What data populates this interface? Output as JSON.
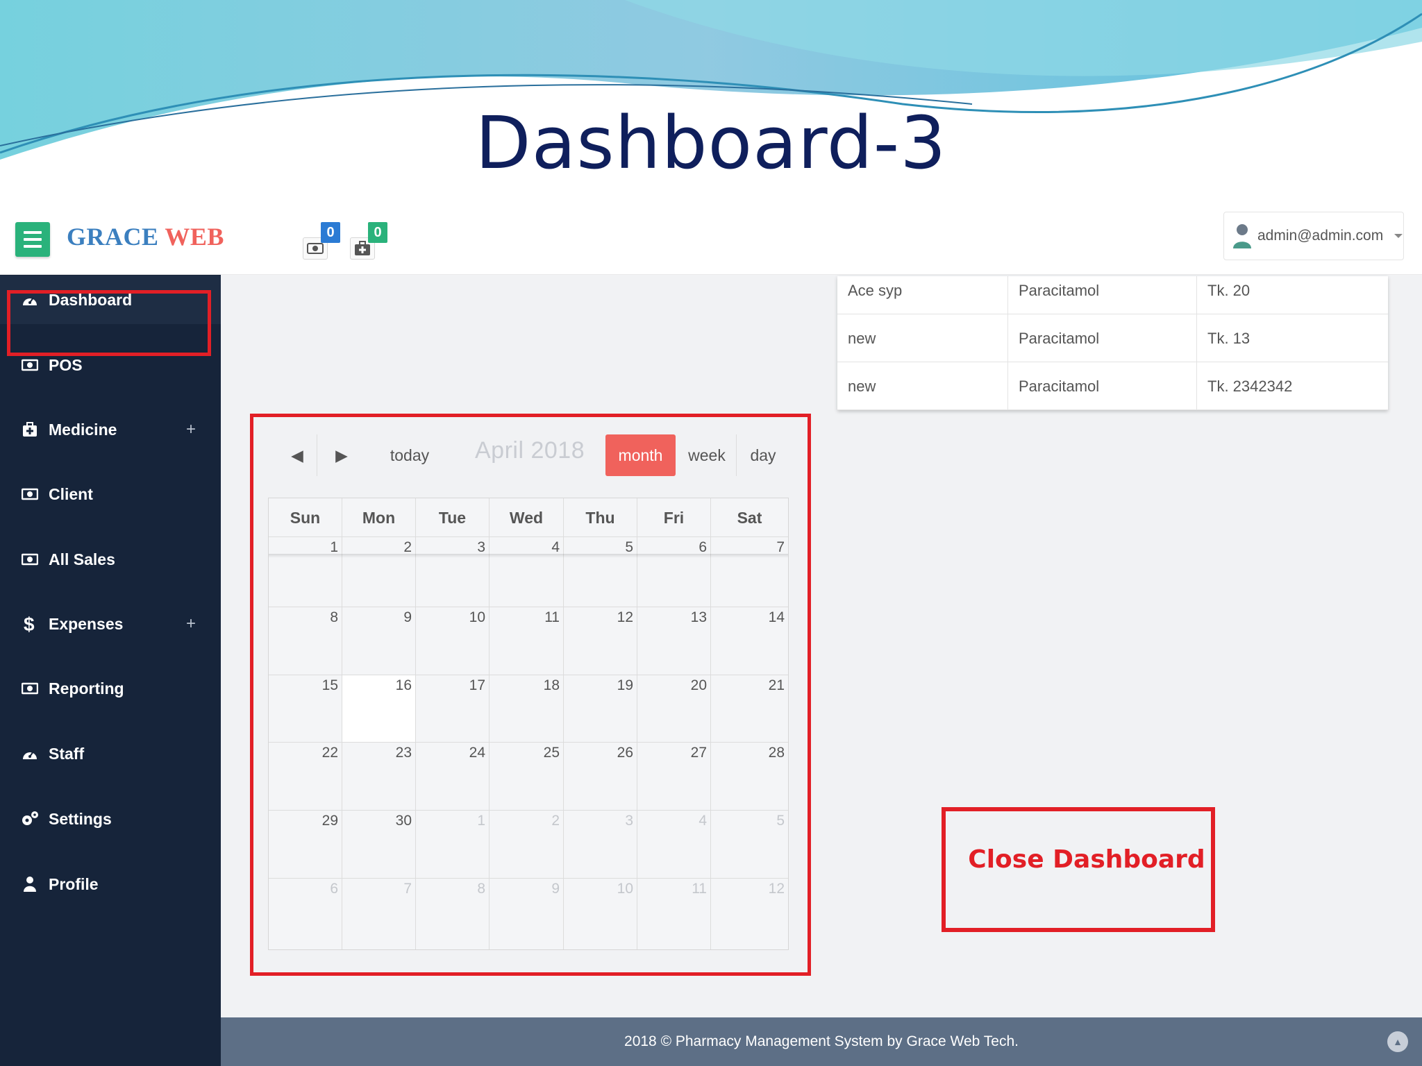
{
  "slide": {
    "title": "Dashboard-3"
  },
  "header": {
    "brand_part1": "GRACE",
    "brand_part2": "WEB",
    "sales_badge": "0",
    "medicine_badge": "0",
    "user": "admin@admin.com"
  },
  "sidebar": {
    "items": [
      {
        "label": "Dashboard",
        "icon": "dashboard-icon"
      },
      {
        "label": "POS",
        "icon": "money-icon"
      },
      {
        "label": "Medicine",
        "icon": "medkit-icon",
        "expand": "+"
      },
      {
        "label": "Client",
        "icon": "money-icon"
      },
      {
        "label": "All Sales",
        "icon": "money-icon"
      },
      {
        "label": "Expenses",
        "icon": "dollar-icon",
        "expand": "+"
      },
      {
        "label": "Reporting",
        "icon": "money-icon"
      },
      {
        "label": "Staff",
        "icon": "dashboard-icon"
      },
      {
        "label": "Settings",
        "icon": "gears-icon"
      },
      {
        "label": "Profile",
        "icon": "user-icon"
      }
    ]
  },
  "table": {
    "rows": [
      [
        "Ace syp",
        "Paracitamol",
        "Tk. 20"
      ],
      [
        "new",
        "Paracitamol",
        "Tk. 13"
      ],
      [
        "new",
        "Paracitamol",
        "Tk. 2342342"
      ]
    ]
  },
  "calendar": {
    "prev": "◀",
    "next": "▶",
    "today": "today",
    "title": "April 2018",
    "views": [
      "month",
      "week",
      "day"
    ],
    "active_view": "month",
    "days": [
      "Sun",
      "Mon",
      "Tue",
      "Wed",
      "Thu",
      "Fri",
      "Sat"
    ],
    "weeks": [
      [
        "1",
        "2",
        "3",
        "4",
        "5",
        "6",
        "7"
      ],
      [
        "8",
        "9",
        "10",
        "11",
        "12",
        "13",
        "14"
      ],
      [
        "15",
        "16",
        "17",
        "18",
        "19",
        "20",
        "21"
      ],
      [
        "22",
        "23",
        "24",
        "25",
        "26",
        "27",
        "28"
      ],
      [
        "29",
        "30",
        "1",
        "2",
        "3",
        "4",
        "5"
      ],
      [
        "6",
        "7",
        "8",
        "9",
        "10",
        "11",
        "12"
      ]
    ],
    "today_date": "16"
  },
  "annotation": {
    "close_label": "Close Dashboard"
  },
  "footer": {
    "text": "2018 © Pharmacy Management System by Grace Web Tech."
  },
  "colors": {
    "accent_red": "#e21f26",
    "sidebar": "#16243a",
    "brand_blue": "#3b7fbf",
    "brand_red": "#f0625c",
    "green": "#2ab27b"
  }
}
